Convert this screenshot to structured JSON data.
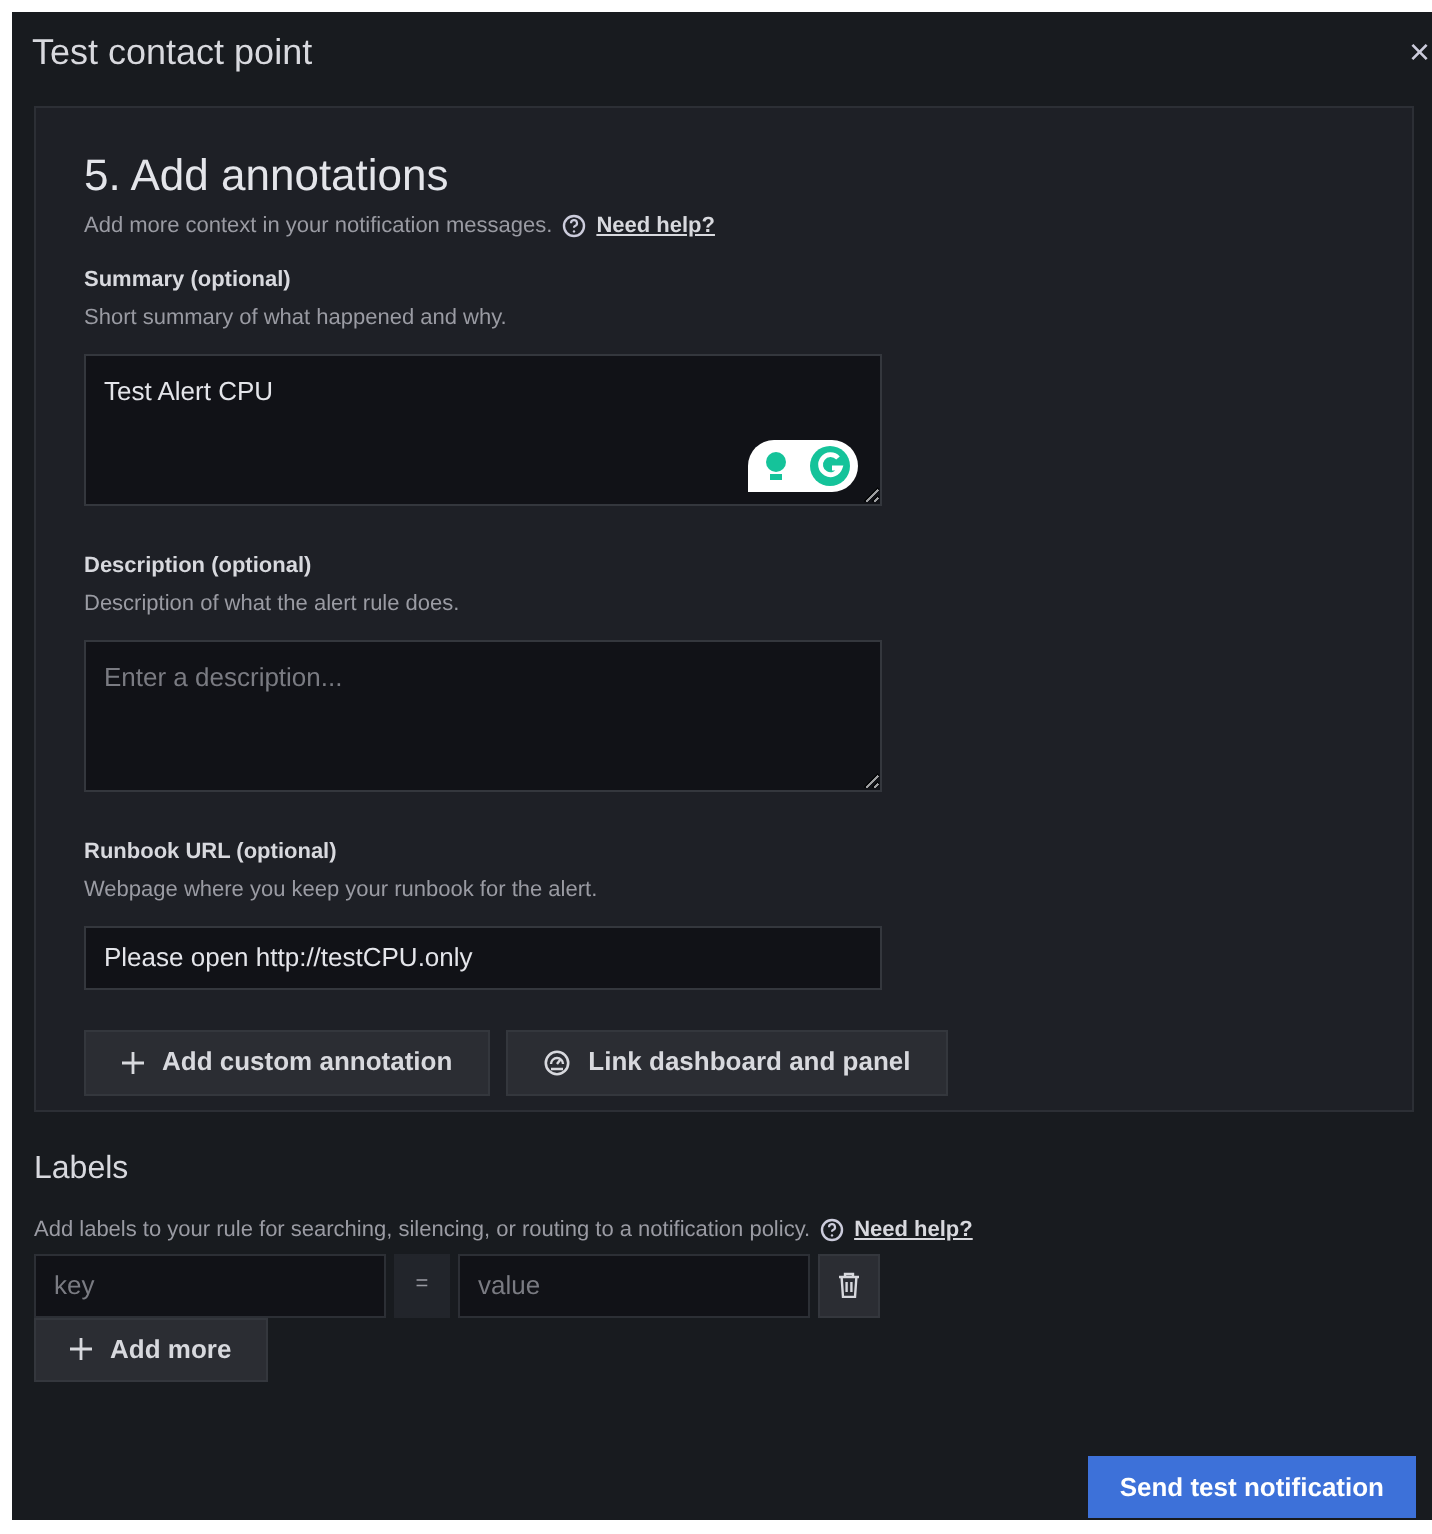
{
  "modal": {
    "title": "Test contact point",
    "close": "×"
  },
  "annotations": {
    "heading": "5. Add annotations",
    "hint": "Add more context in your notification messages.",
    "help_link": "Need help?",
    "fields": [
      {
        "kind": "textarea",
        "label": "Summary (optional)",
        "hint": "Short summary of what happened and why.",
        "value": "Test Alert CPU",
        "assistant_badge": true
      },
      {
        "kind": "textarea",
        "label": "Description (optional)",
        "hint": "Description of what the alert rule does.",
        "placeholder": "Enter a description..."
      },
      {
        "kind": "input",
        "label": "Runbook URL (optional)",
        "hint": "Webpage where you keep your runbook for the alert.",
        "value": "Please open http://testCPU.only"
      }
    ],
    "buttons": [
      {
        "kind": "plus",
        "label": "Add custom annotation"
      },
      {
        "kind": "dashboard",
        "label": "Link dashboard and panel"
      }
    ]
  },
  "labels": {
    "heading": "Labels",
    "hint": "Add labels to your rule for searching, silencing, or routing to a notification policy.",
    "help_link": "Need help?",
    "rows": [
      {
        "key_placeholder": "key",
        "operator": "=",
        "value_placeholder": "value"
      }
    ],
    "add_button": "Add more"
  },
  "submit": "Send test notification"
}
